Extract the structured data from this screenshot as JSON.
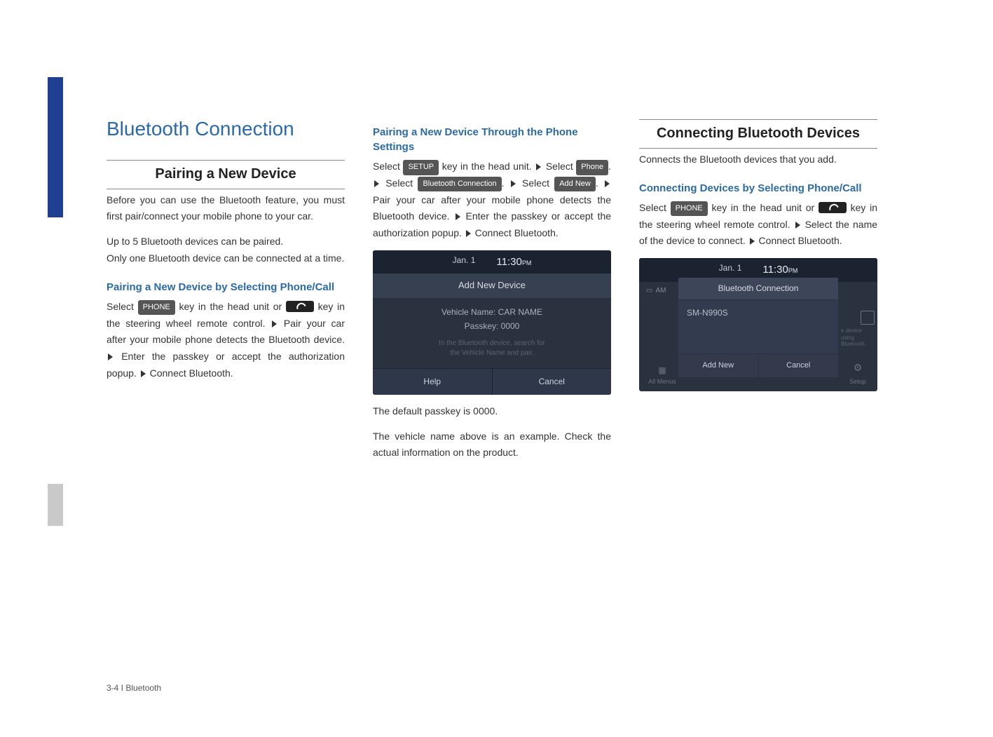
{
  "page_title": "Bluetooth Connection",
  "footer": "3-4 I Bluetooth",
  "col1": {
    "heading": "Pairing a New Device",
    "intro1": "Before you can use the Bluetooth feature, you must first pair/connect your mobile phone to your car.",
    "intro2": "Up to 5 Bluetooth devices can be paired.",
    "intro3": "Only one Bluetooth device can be connected at a time.",
    "sub1": "Pairing a New Device by Selecting Phone/Call",
    "sub1_select": "Select ",
    "sub1_phone_btn": "PHONE",
    "sub1_text1": " key in the head unit or ",
    "sub1_text2": " key in the steering wheel remote control. ",
    "sub1_text3": " Pair your car after your mobile phone detects the Bluetooth device. ",
    "sub1_text4": " Enter the passkey or accept the authorization popup. ",
    "sub1_text5": " Connect Bluetooth."
  },
  "col2": {
    "sub1": "Pairing a New Device Through the Phone Settings",
    "select_word": "Select ",
    "setup_btn": "SETUP",
    "text1": " key in the head unit. ",
    "phone_btn": "Phone",
    "period_text": ". ",
    "bt_conn_btn": "Bluetooth Connection",
    "addnew_btn": "Add New",
    "text3a": " Pair your car after your mobile phone detects the Bluetooth device. ",
    "text3b": " Enter the passkey or accept the authorization popup. ",
    "text3c": " Connect Bluetooth.",
    "screenshot": {
      "date": "Jan.  1",
      "time": "11:30",
      "ampm": "PM",
      "dialog_title": "Add New Device",
      "vehicle_label": "Vehicle Name: CAR NAME",
      "passkey_label": "Passkey: 0000",
      "hint1": "In the Bluetooth device, search for",
      "hint2": "the Vehicle Name and pair.",
      "help": "Help",
      "cancel": "Cancel"
    },
    "note1": "The default passkey is 0000.",
    "note2": "The vehicle name above is an example. Check the actual information on the product."
  },
  "col3": {
    "heading": "Connecting Bluetooth Devices",
    "intro": "Connects the Bluetooth devices that you add.",
    "sub1": "Connecting Devices by Selecting Phone/Call",
    "select_word": "Select ",
    "phone_btn": "PHONE",
    "text1": " key in the head unit or ",
    "text2": " key in the steering wheel remote control. ",
    "text3": " Select the name of the device to connect. ",
    "text4": " Connect Bluetooth.",
    "screenshot": {
      "date": "Jan.  1",
      "time": "11:30",
      "ampm": "PM",
      "am_label": "AM",
      "dialog_title": "Bluetooth Connection",
      "device": "SM-N990S",
      "right_hint": "e device using Bluetooth",
      "add_new": "Add New",
      "cancel": "Cancel",
      "all_menus": "All Menus",
      "setup": "Setup"
    }
  }
}
